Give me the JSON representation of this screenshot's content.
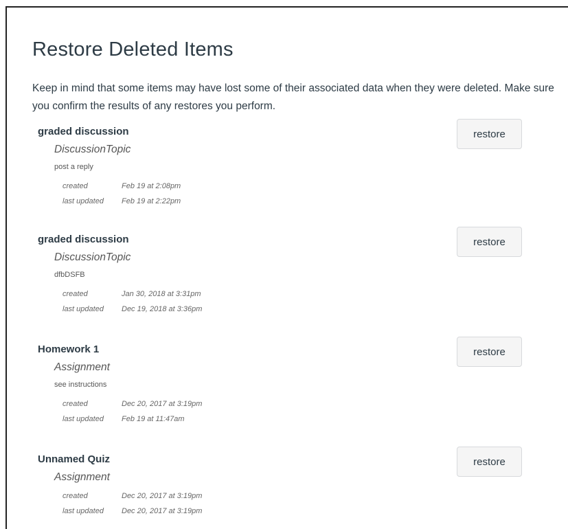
{
  "page": {
    "title": "Restore Deleted Items",
    "intro": "Keep in mind that some items may have lost some of their associated data when they were deleted. Make sure you confirm the results of any restores you perform."
  },
  "labels": {
    "created": "created",
    "last_updated": "last updated",
    "restore": "restore"
  },
  "items": [
    {
      "title": "graded discussion",
      "type": "DiscussionTopic",
      "description": "post a  reply",
      "created": "Feb 19 at 2:08pm",
      "last_updated": "Feb 19 at 2:22pm"
    },
    {
      "title": "graded discussion",
      "type": "DiscussionTopic",
      "description": "dfbDSFB",
      "created": "Jan 30, 2018 at 3:31pm",
      "last_updated": "Dec 19, 2018 at 3:36pm"
    },
    {
      "title": "Homework 1",
      "type": "Assignment",
      "description": "see instructions",
      "created": "Dec 20, 2017 at 3:19pm",
      "last_updated": "Feb 19 at 11:47am"
    },
    {
      "title": "Unnamed Quiz",
      "type": "Assignment",
      "description": "",
      "created": "Dec 20, 2017 at 3:19pm",
      "last_updated": "Dec 20, 2017 at 3:19pm"
    }
  ]
}
